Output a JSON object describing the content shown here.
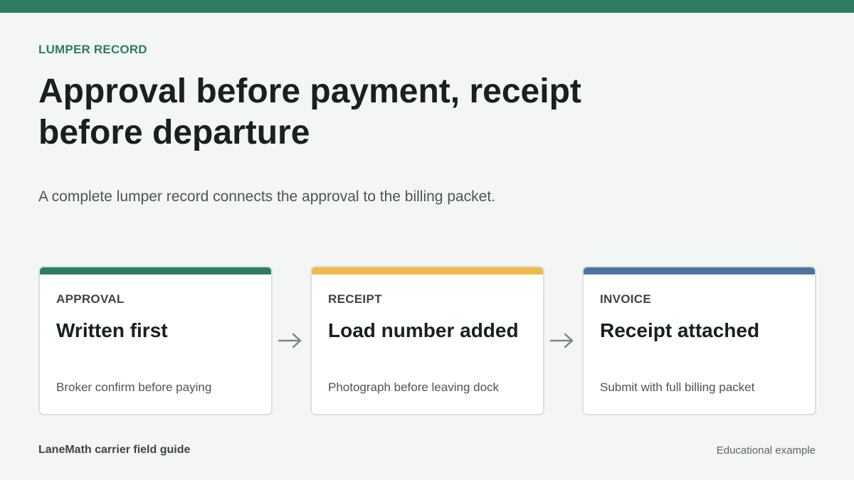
{
  "header": {
    "eyebrow": "LUMPER RECORD",
    "title": "Approval before payment, receipt before departure",
    "subtitle": "A complete lumper record connects the approval to the billing packet."
  },
  "cards": [
    {
      "label": "APPROVAL",
      "headline": "Written first",
      "note": "Broker confirm before paying",
      "accent": "#2e7d63"
    },
    {
      "label": "RECEIPT",
      "headline": "Load number added",
      "note": "Photograph before leaving dock",
      "accent": "#f0b94a"
    },
    {
      "label": "INVOICE",
      "headline": "Receipt attached",
      "note": "Submit with full billing packet",
      "accent": "#4c74a0"
    }
  ],
  "icons": {
    "flow_arrow": "arrow-right-icon"
  },
  "colors": {
    "brand": "#2e7d63",
    "arrow": "#7d8782"
  },
  "footer": {
    "left": "LaneMath carrier field guide",
    "right": "Educational example"
  }
}
